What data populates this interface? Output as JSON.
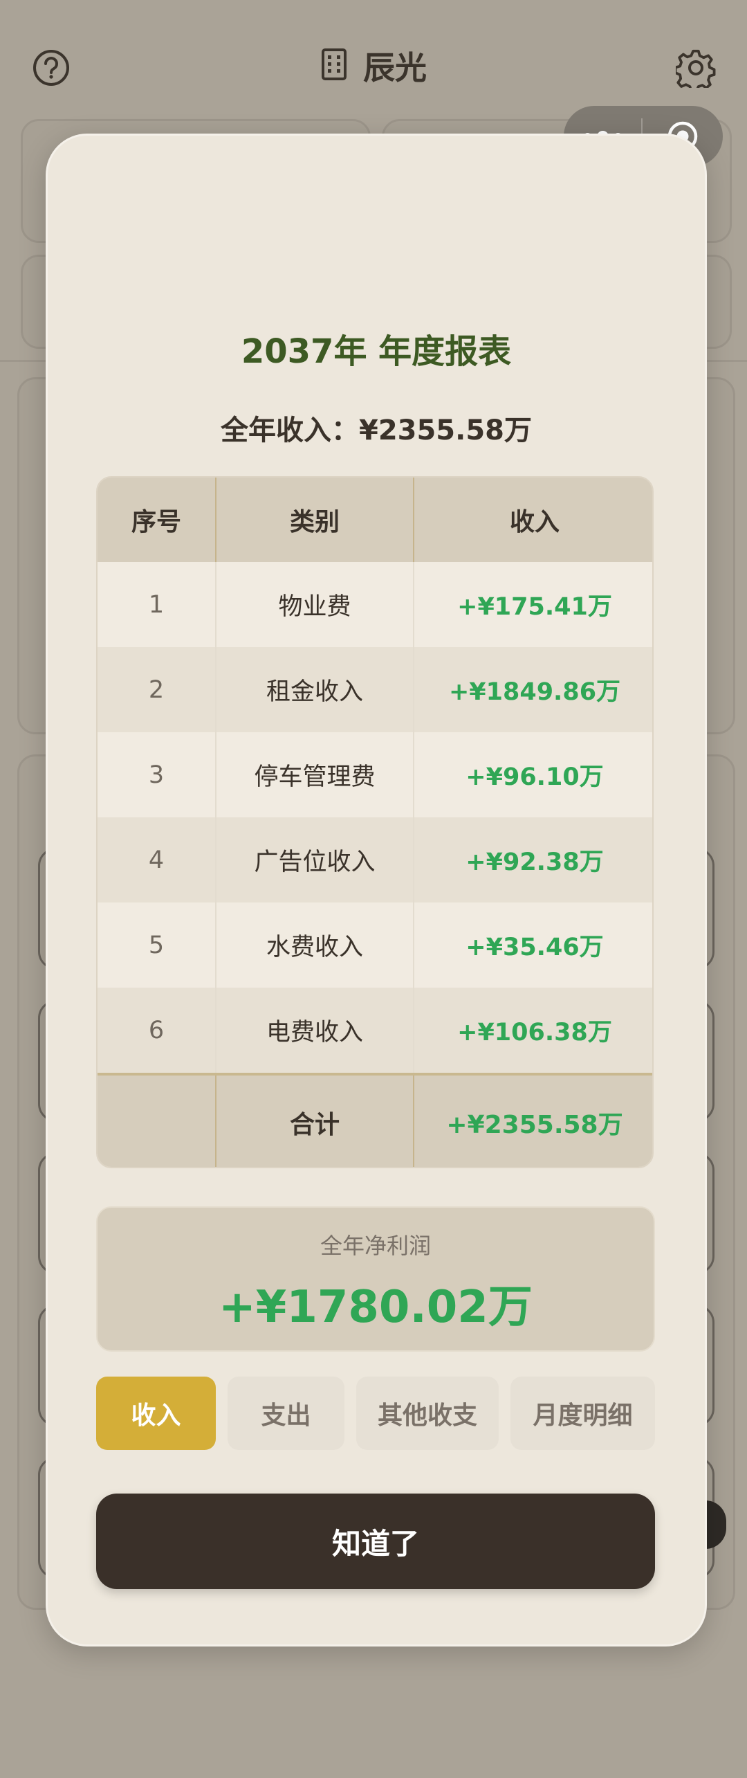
{
  "header": {
    "title": "辰光",
    "help_icon": "question-circle-icon",
    "building_icon": "building-icon",
    "settings_icon": "gear-icon"
  },
  "capsule": {
    "more_icon": "more-dots-icon",
    "close_icon": "target-close-icon"
  },
  "modal": {
    "title": "2037年 年度报表",
    "subtitle": "全年收入：¥2355.58万",
    "table": {
      "headers": [
        "序号",
        "类别",
        "收入"
      ],
      "rows": [
        {
          "no": "1",
          "category": "物业费",
          "amount": "+¥175.41万"
        },
        {
          "no": "2",
          "category": "租金收入",
          "amount": "+¥1849.86万"
        },
        {
          "no": "3",
          "category": "停车管理费",
          "amount": "+¥96.10万"
        },
        {
          "no": "4",
          "category": "广告位收入",
          "amount": "+¥92.38万"
        },
        {
          "no": "5",
          "category": "水费收入",
          "amount": "+¥35.46万"
        },
        {
          "no": "6",
          "category": "电费收入",
          "amount": "+¥106.38万"
        }
      ],
      "total": {
        "label": "合计",
        "amount": "+¥2355.58万"
      }
    },
    "profit": {
      "label": "全年净利润",
      "value": "+¥1780.02万"
    },
    "tabs": [
      {
        "label": "收入",
        "active": true
      },
      {
        "label": "支出",
        "active": false
      },
      {
        "label": "其他收支",
        "active": false
      },
      {
        "label": "月度明细",
        "active": false
      }
    ],
    "ok_label": "知道了"
  },
  "colors": {
    "positive": "#2fa655",
    "title_green": "#3d5a23",
    "accent_gold": "#d4ae38",
    "dark_button": "#3a3029"
  }
}
